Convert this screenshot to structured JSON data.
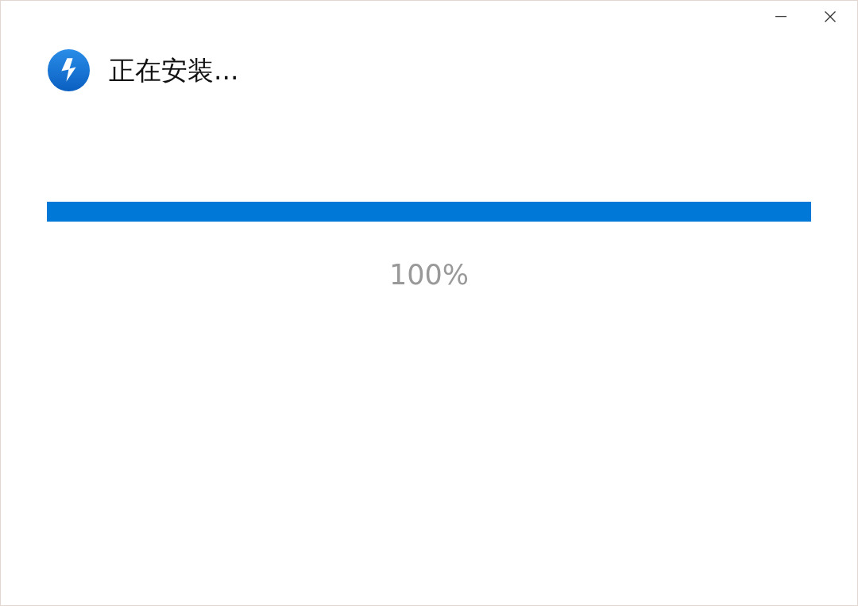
{
  "header": {
    "title": "正在安装..."
  },
  "progress": {
    "level": 1,
    "reading": "100%"
  }
}
